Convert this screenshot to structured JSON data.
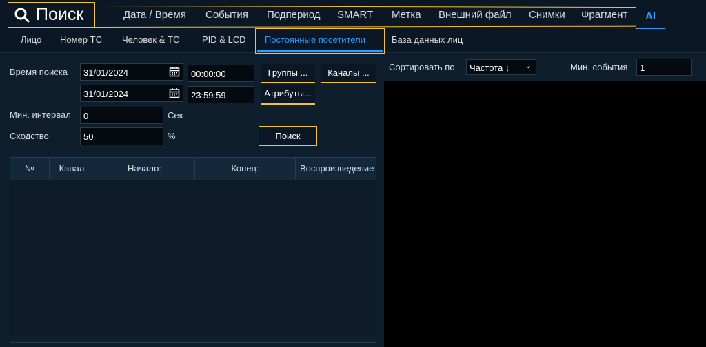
{
  "header": {
    "title": "Поиск",
    "tabs": [
      "Дата / Время",
      "События",
      "Подпериод",
      "SMART",
      "Метка",
      "Внешний файл",
      "Снимки",
      "Фрагмент"
    ],
    "active_tab": "AI"
  },
  "subtabs": {
    "items": [
      "Лицо",
      "Номер ТС",
      "Человек & ТС",
      "PID & LCD",
      "Постоянные посетители",
      "База данных лиц"
    ]
  },
  "search": {
    "time_label": "Время поиска",
    "start_date": "31/01/2024",
    "start_time": "00:00:00",
    "end_date": "31/01/2024",
    "end_time": "23:59:59",
    "groups_button": "Группы ...",
    "channels_button": "Каналы ...",
    "attributes_button": "Атрибуты...",
    "min_interval_label": "Мин. интервал",
    "min_interval_value": "0",
    "min_interval_unit": "Сек",
    "similarity_label": "Сходство",
    "similarity_value": "50",
    "similarity_unit": "%",
    "search_button": "Поиск"
  },
  "table": {
    "columns": [
      "№",
      "Канал",
      "Начало:",
      "Конец:",
      "Воспроизведение"
    ]
  },
  "right": {
    "sort_label": "Сортировать по",
    "sort_value": "Частота ↓",
    "min_events_label": "Мин. события",
    "min_events_value": "1"
  },
  "colors": {
    "accent": "#2d9cff",
    "highlight": "#f2c230"
  }
}
